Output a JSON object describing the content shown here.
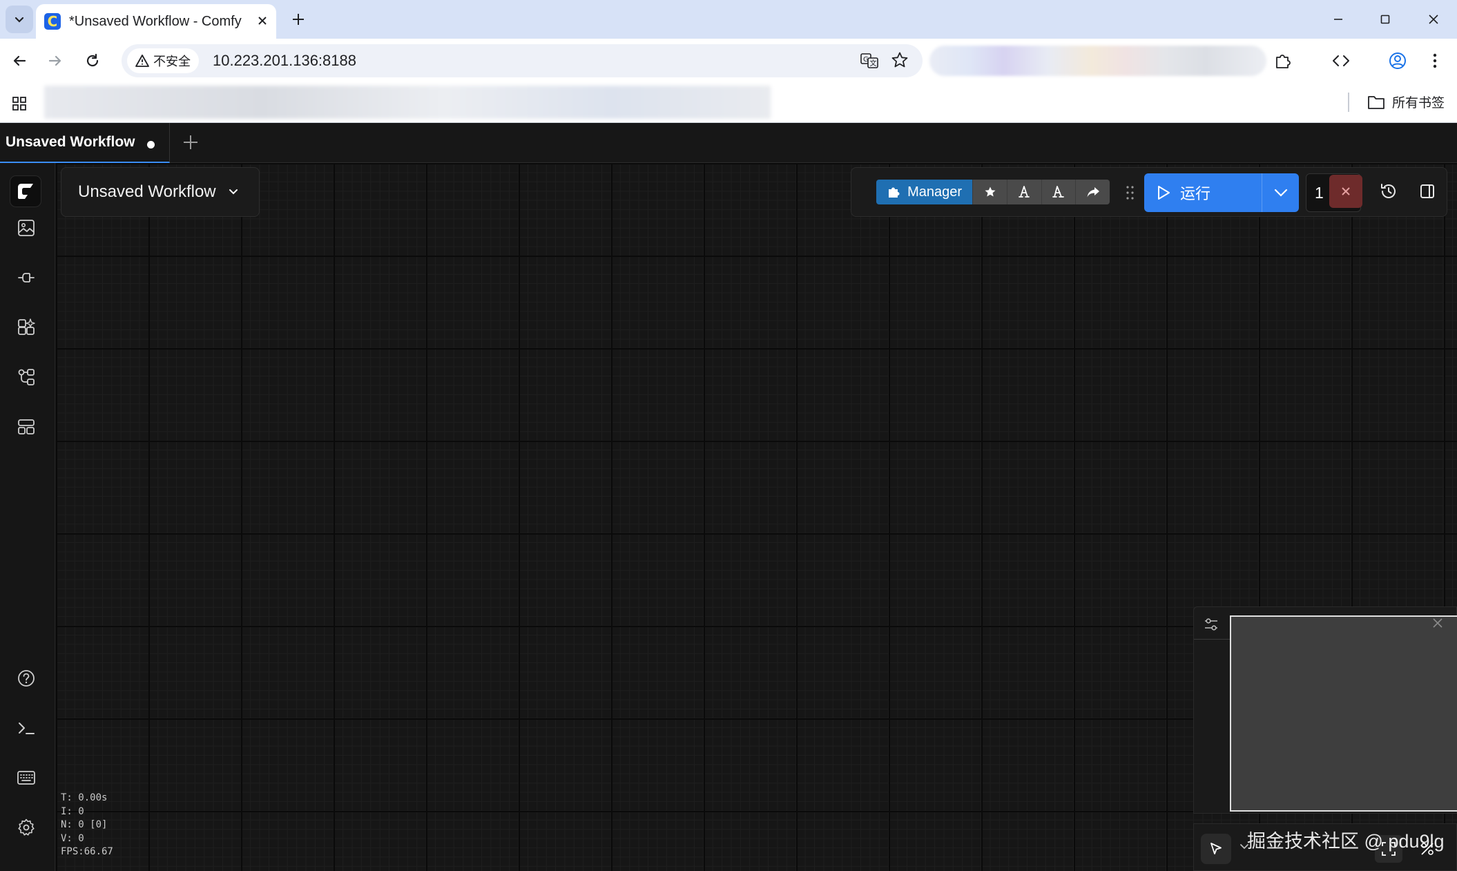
{
  "browser": {
    "tab_title": "*Unsaved Workflow - ComfyUI",
    "favicon_glyph": "C",
    "url": "10.223.201.136:8188",
    "security_label": "不安全",
    "all_bookmarks_label": "所有书签"
  },
  "app": {
    "workflow_tab": {
      "label": "Unsaved Workflow",
      "unsaved": true
    },
    "workflow_title": "Unsaved Workflow",
    "actionbar": {
      "manager_label": "Manager",
      "run_label": "运行",
      "batch_count": "1"
    },
    "sidebar_icons": [
      "image-gallery-icon",
      "model-library-icon",
      "node-library-icon",
      "workflows-icon",
      "templates-icon",
      "help-icon",
      "terminal-icon",
      "keyboard-icon",
      "settings-icon"
    ],
    "stats": {
      "t": "T: 0.00s",
      "i": "I: 0",
      "n": "N: 0 [0]",
      "v": "V: 0",
      "fps": "FPS:66.67"
    },
    "watermark": "掘金技术社区 @ pdu9lg"
  },
  "colors": {
    "accent": "#2f7ff0",
    "manager": "#1f6fb2",
    "cancel": "#6e2b2b",
    "canvas_bg": "#161616"
  }
}
